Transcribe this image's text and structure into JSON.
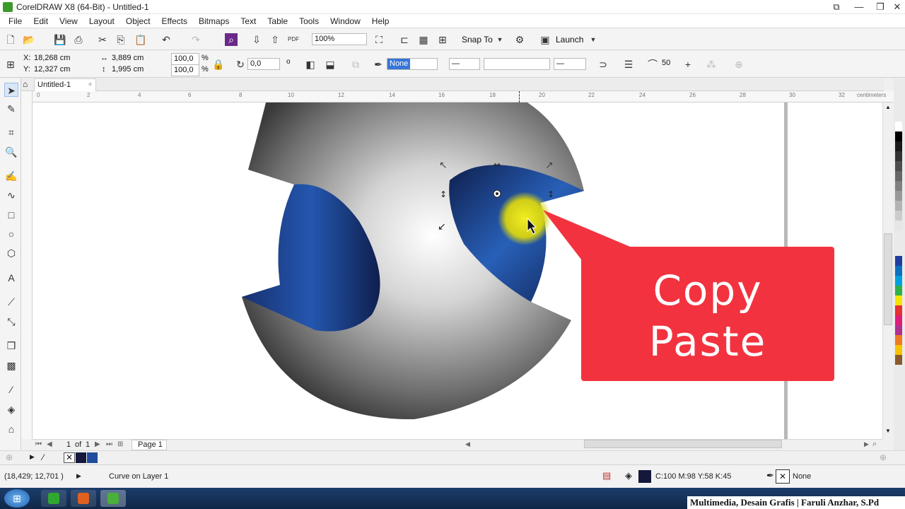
{
  "window": {
    "title": "CorelDRAW X8 (64-Bit) - Untitled-1"
  },
  "menu": [
    "File",
    "Edit",
    "View",
    "Layout",
    "Object",
    "Effects",
    "Bitmaps",
    "Text",
    "Table",
    "Tools",
    "Window",
    "Help"
  ],
  "standard_toolbar": {
    "zoom": "100%",
    "snap_to": "Snap To",
    "launch": "Launch"
  },
  "property_bar": {
    "x_label": "X:",
    "x_value": "18,268 cm",
    "y_label": "Y:",
    "y_value": "12,327 cm",
    "width_value": "3,889 cm",
    "height_value": "1,995 cm",
    "scale_w": "100,0",
    "scale_h": "100,0",
    "percent": "%",
    "rotation": "0,0",
    "degree_symbol": "o",
    "outline_width": "None",
    "smoothing": "50"
  },
  "document_tab": "Untitled-1",
  "ruler": {
    "units": "centimeters",
    "ticks": [
      "0",
      "2",
      "4",
      "6",
      "8",
      "10",
      "12",
      "14",
      "16",
      "18",
      "20",
      "22",
      "24",
      "26",
      "28",
      "30",
      "32"
    ]
  },
  "callout": {
    "line1": "Copy",
    "line2": "Paste",
    "color": "#f2333f"
  },
  "page_nav": {
    "current": "1",
    "of": "of",
    "total": "1",
    "page_tab": "Page 1"
  },
  "status": {
    "cursor": "(18,429; 12,701 )",
    "object_info": "Curve on Layer 1",
    "fill_values": "C:100 M:98 Y:58 K:45",
    "outline": "None"
  },
  "watermark": "Multimedia, Desain Grafis | Faruli Anzhar, S.Pd",
  "colors": {
    "fill": "#14183a",
    "accent_blue": "#1f4c9c",
    "palette": [
      "#ffffff",
      "#000000",
      "#1a1a1a",
      "#333333",
      "#4d4d4d",
      "#666666",
      "#808080",
      "#999999",
      "#b3b3b3",
      "#cccccc",
      "#e6e6e6",
      "#1f3f9f",
      "#0d6fbf",
      "#00a0e0",
      "#2fb04a",
      "#f5e400",
      "#e83030",
      "#e21c7a",
      "#b03090",
      "#f07a20",
      "#f5c400",
      "#8a5a2a"
    ]
  }
}
